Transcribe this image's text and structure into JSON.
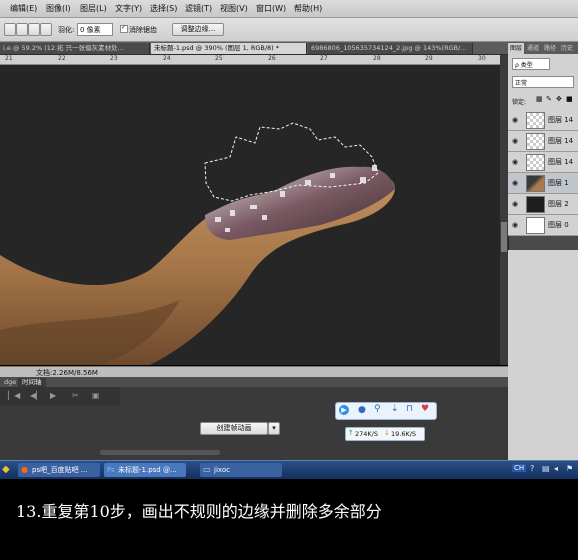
{
  "menu": [
    "编辑(E)",
    "图像(I)",
    "图层(L)",
    "文字(Y)",
    "选择(S)",
    "滤镜(T)",
    "视图(V)",
    "窗口(W)",
    "帮助(H)"
  ],
  "options": {
    "feather_label": "羽化:",
    "feather_value": "0 像素",
    "antialias_label": "消除锯齿",
    "refine_button": "调整边缘..."
  },
  "tabs": [
    {
      "label": "i.e @ 59.2% (12.拓 只一张偏灰素材处..."
    },
    {
      "label": "未标题-1.psd @ 390% (图层 1, RGB/8) *"
    },
    {
      "label": "6986806_105635734124_2.jpg @ 143%(RGB/..."
    }
  ],
  "ruler": [
    "21",
    "22",
    "23",
    "24",
    "25",
    "26",
    "27",
    "28",
    "29",
    "30"
  ],
  "status": {
    "doc": "文档:2.26M/8.56M"
  },
  "timeline": {
    "tabs": [
      "dge",
      "时间轴"
    ],
    "create_button": "创建帧动画"
  },
  "panel": {
    "tabs": [
      "图层",
      "通道",
      "路径",
      "历史"
    ],
    "kind_label": "ρ 类型",
    "blend_mode": "正常",
    "lock_label": "锁定:",
    "layers": [
      {
        "name": "图层 14",
        "type": "transparent"
      },
      {
        "name": "图层 14",
        "type": "transparent"
      },
      {
        "name": "图层 14",
        "type": "transparent"
      },
      {
        "name": "图层 1",
        "type": "finger",
        "selected": true
      },
      {
        "name": "图层 2",
        "type": "dark"
      },
      {
        "name": "图层 0",
        "type": "white"
      }
    ]
  },
  "network": {
    "upload": "274K/S",
    "download": "19.6K/S"
  },
  "taskbar": {
    "items": [
      "ps吧_百度贴吧 ...",
      "未标题-1.psd @...",
      "jixoc"
    ],
    "lang": "CH"
  },
  "caption": "13.重复第10步，画出不规则的边缘并删除多余部分",
  "colors": {
    "canvas": "#262626",
    "finger": "#a97a4f",
    "taskbar": "#1f3f73"
  }
}
